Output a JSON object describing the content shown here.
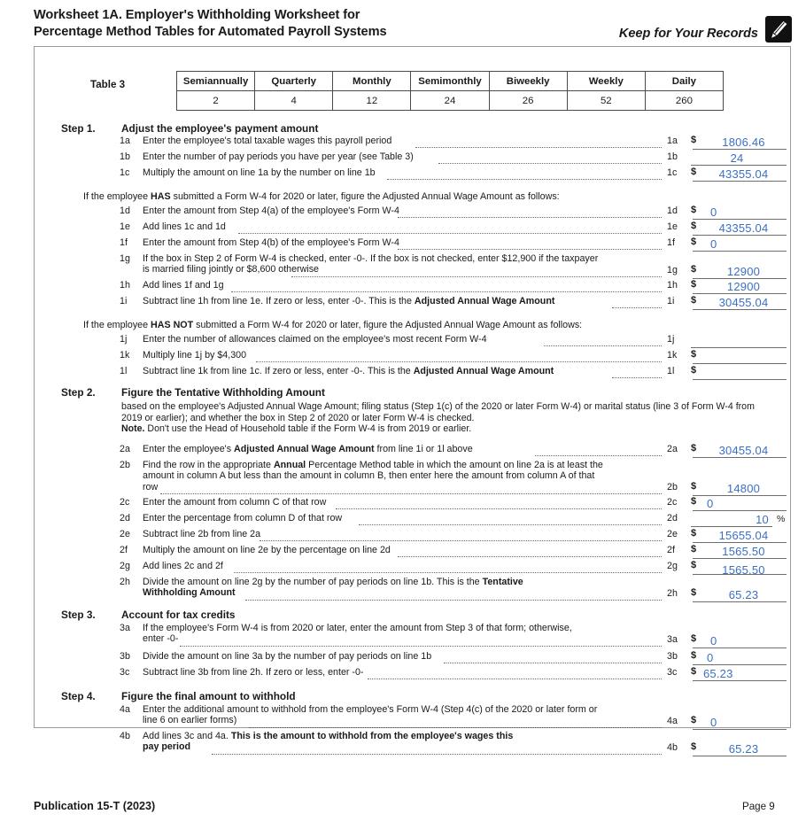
{
  "header": {
    "title_line1": "Worksheet 1A. Employer's Withholding Worksheet for",
    "title_line2": "Percentage Method Tables for Automated Payroll Systems",
    "keep_for_records": "Keep for Your Records",
    "icon": "pen-icon"
  },
  "table3": {
    "label": "Table 3",
    "headers": [
      "Semiannually",
      "Quarterly",
      "Monthly",
      "Semimonthly",
      "Biweekly",
      "Weekly",
      "Daily"
    ],
    "values": [
      "2",
      "4",
      "12",
      "24",
      "26",
      "52",
      "260"
    ]
  },
  "step1": {
    "label": "Step 1.",
    "title": "Adjust the employee's payment amount",
    "intro_has": "If the employee HAS submitted a Form W-4 for 2020 or later, figure the Adjusted Annual Wage Amount as follows:",
    "intro_has_not": "If the employee HAS NOT submitted a Form W-4 for 2020 or later, figure the Adjusted Annual Wage Amount as follows:",
    "lines": [
      {
        "num": "1a",
        "desc": "Enter the employee's total taxable wages this payroll period",
        "dollar": "$",
        "value": "1806.46"
      },
      {
        "num": "1b",
        "desc": "Enter the number of pay periods you have per year (see Table 3)",
        "dollar": "",
        "value": "24"
      },
      {
        "num": "1c",
        "desc": "Multiply the amount on line 1a by the number on line 1b",
        "dollar": "$",
        "value": "43355.04"
      },
      {
        "num": "1d",
        "desc": "Enter the amount from Step 4(a) of the employee's Form W-4",
        "dollar": "$",
        "value": "0"
      },
      {
        "num": "1e",
        "desc": "Add lines 1c and 1d",
        "dollar": "$",
        "value": "43355.04"
      },
      {
        "num": "1f",
        "desc": "Enter the amount from Step 4(b) of the employee's Form W-4",
        "dollar": "$",
        "value": "0"
      },
      {
        "num": "1g",
        "desc_l1": "If the box in Step 2 of Form W-4 is checked, enter -0-. If the box is not checked, enter $12,900 if the taxpayer",
        "desc_l2": "is married filing jointly or $8,600 otherwise",
        "dollar": "$",
        "value": "12900"
      },
      {
        "num": "1h",
        "desc": "Add lines 1f and 1g",
        "dollar": "$",
        "value": "12900"
      },
      {
        "num": "1i",
        "desc_pre": "Subtract line 1h from line 1e. If zero or less, enter -0-. This is the ",
        "desc_bold": "Adjusted Annual Wage Amount",
        "dollar": "$",
        "value": "30455.04"
      },
      {
        "num": "1j",
        "desc": "Enter the number of allowances claimed on the employee's most recent Form W-4",
        "dollar": "",
        "value": ""
      },
      {
        "num": "1k",
        "desc": "Multiply line 1j by $4,300",
        "dollar": "$",
        "value": ""
      },
      {
        "num": "1l",
        "desc_pre": "Subtract line 1k from line 1c. If zero or less, enter -0-. This is the ",
        "desc_bold": "Adjusted Annual Wage Amount",
        "dollar": "$",
        "value": ""
      }
    ]
  },
  "step2": {
    "label": "Step 2.",
    "title": "Figure the Tentative Withholding Amount",
    "sub_line1": "based on the employee's Adjusted Annual Wage Amount; filing status (Step 1(c) of the 2020 or later Form W-4) or marital status (line 3 of",
    "sub_line2": "Form W-4 from 2019 or earlier); and whether the box in Step 2 of 2020 or later Form W-4 is checked.",
    "note_label": "Note.",
    "note_text": " Don't use the Head of Household table if the Form W-4 is from 2019 or earlier.",
    "lines": [
      {
        "num": "2a",
        "desc_pre": "Enter the employee's ",
        "desc_bold": "Adjusted Annual Wage Amount",
        "desc_post": " from line 1i or 1l above",
        "dollar": "$",
        "value": "30455.04"
      },
      {
        "num": "2b",
        "desc_l1_pre": "Find the row in the appropriate ",
        "desc_l1_bold": "Annual",
        "desc_l1_post": " Percentage Method table in which the amount on line 2a is at least the",
        "desc_l2": "amount in column A but less than the amount in column B, then enter here the amount from column A of that",
        "desc_l3": "row",
        "dollar": "$",
        "value": "14800"
      },
      {
        "num": "2c",
        "desc": "Enter the amount from column C of that row",
        "dollar": "$",
        "value": "0"
      },
      {
        "num": "2d",
        "desc": "Enter the percentage from column D of that row",
        "dollar": "",
        "value": "10",
        "suffix": "%"
      },
      {
        "num": "2e",
        "desc": "Subtract line 2b from line 2a",
        "dollar": "$",
        "value": "15655.04"
      },
      {
        "num": "2f",
        "desc": "Multiply the amount on line 2e by the percentage on line 2d",
        "dollar": "$",
        "value": "1565.50"
      },
      {
        "num": "2g",
        "desc": "Add lines 2c and 2f",
        "dollar": "$",
        "value": "1565.50"
      },
      {
        "num": "2h",
        "desc_l1": "Divide the amount on line 2g by the number of pay periods on line 1b. This is the ",
        "desc_l1_bold": "Tentative",
        "desc_l2_bold": "Withholding Amount",
        "dollar": "$",
        "value": "65.23"
      }
    ]
  },
  "step3": {
    "label": "Step 3.",
    "title": "Account for tax credits",
    "lines": [
      {
        "num": "3a",
        "desc_l1": "If the employee's Form W-4 is from 2020 or later, enter the amount from Step 3 of that form; otherwise,",
        "desc_l2": "enter -0-",
        "dollar": "$",
        "value": "0"
      },
      {
        "num": "3b",
        "desc": "Divide the amount on line 3a by the number of pay periods on line 1b",
        "dollar": "$",
        "value": "0"
      },
      {
        "num": "3c",
        "desc": "Subtract line 3b from line 2h. If zero or less, enter -0-",
        "dollar": "$",
        "value": "65.23"
      }
    ]
  },
  "step4": {
    "label": "Step 4.",
    "title": "Figure the final amount to withhold",
    "lines": [
      {
        "num": "4a",
        "desc_l1": "Enter the additional amount to withhold from the employee's Form W-4 (Step 4(c) of the 2020 or later form or",
        "desc_l2": "line 6 on earlier forms)",
        "dollar": "$",
        "value": "0"
      },
      {
        "num": "4b",
        "desc_l1_pre": "Add lines 3c and 4a. ",
        "desc_l1_bold": "This is the amount to withhold from the employee's wages this",
        "desc_l2_bold": "pay period",
        "dollar": "$",
        "value": "65.23"
      }
    ]
  },
  "footer": {
    "publication": "Publication 15-T (2023)",
    "page": "Page 9"
  },
  "colors": {
    "entry_blue": "#3b6fc4",
    "rule_gray": "#6e6e6e",
    "box_gray": "#9a9a9a"
  }
}
